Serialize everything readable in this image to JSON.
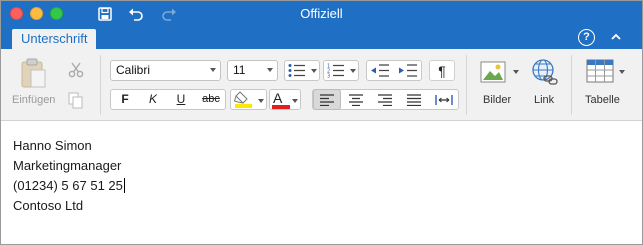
{
  "window": {
    "title": "Offiziell"
  },
  "tabs": {
    "active_label": "Unterschrift",
    "help_glyph": "?"
  },
  "ribbon": {
    "clipboard": {
      "paste_label": "Einfügen"
    },
    "font": {
      "family": "Calibri",
      "size": "11",
      "bold": "F",
      "italic": "K",
      "underline": "U",
      "strikethrough": "abc",
      "highlight_color": "#ffe800",
      "font_color": "#e02020",
      "font_color_glyph": "A"
    },
    "paragraph": {
      "pilcrow": "¶",
      "active_alignment": "left"
    },
    "insert": {
      "pictures_label": "Bilder",
      "link_label": "Link",
      "table_label": "Tabelle"
    }
  },
  "document": {
    "lines": [
      "Hanno Simon",
      "Marketingmanager",
      "(01234) 5 67 51 25",
      "Contoso Ltd"
    ]
  },
  "colors": {
    "accent": "#1f6fc5"
  }
}
